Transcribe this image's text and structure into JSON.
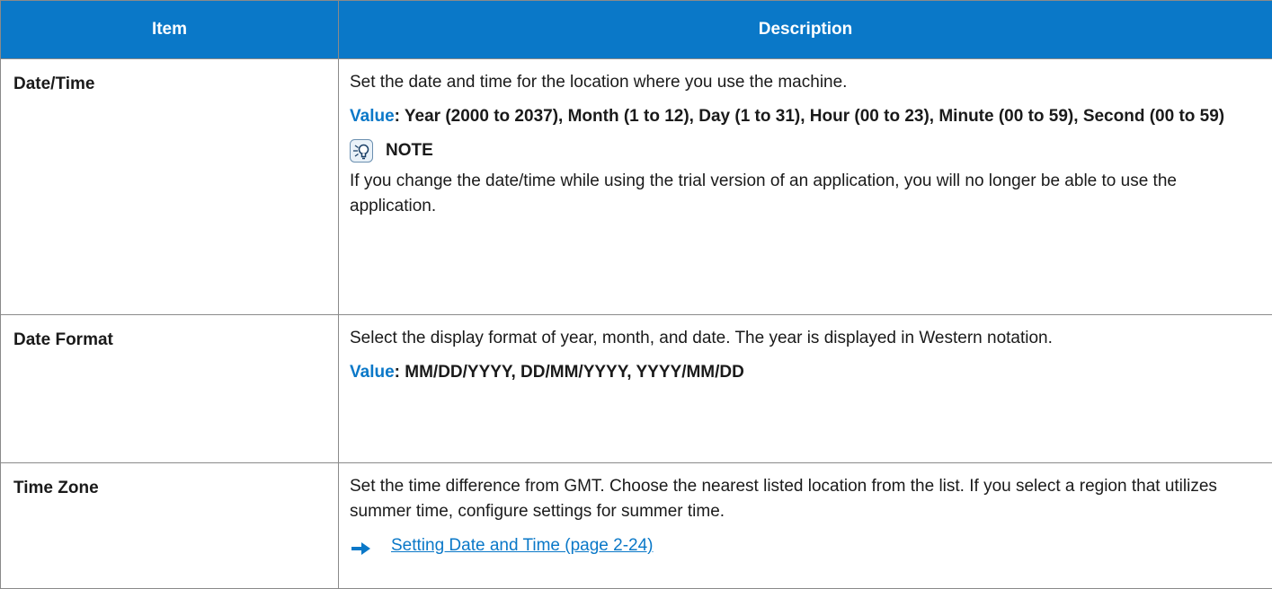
{
  "header": {
    "item": "Item",
    "description": "Description"
  },
  "rows": [
    {
      "item": "Date/Time",
      "desc": "Set the date and time for the location where you use the machine.",
      "value_label": "Value",
      "value_text": ": Year (2000 to 2037), Month (1 to 12), Day (1 to 31), Hour (00 to 23), Minute (00 to 59), Second (00 to 59)",
      "note_title": "NOTE",
      "note_text": "If you change the date/time while using the trial version of an application, you will no longer be able to use the application."
    },
    {
      "item": "Date Format",
      "desc": "Select the display format of year, month, and date. The year is displayed in Western notation.",
      "value_label": "Value",
      "value_text": ": MM/DD/YYYY, DD/MM/YYYY, YYYY/MM/DD"
    },
    {
      "item": "Time Zone",
      "desc": "Set the time difference from GMT. Choose the nearest listed location from the list. If you select a region that utilizes summer time, configure settings for summer time.",
      "link": "Setting Date and Time (page 2-24)"
    }
  ],
  "colors": {
    "header_bg": "#0a78c8",
    "accent": "#0a78c8",
    "border": "#8a8a8a"
  },
  "icons": {
    "note": "lightbulb-note-icon",
    "link": "right-arrow-icon"
  }
}
